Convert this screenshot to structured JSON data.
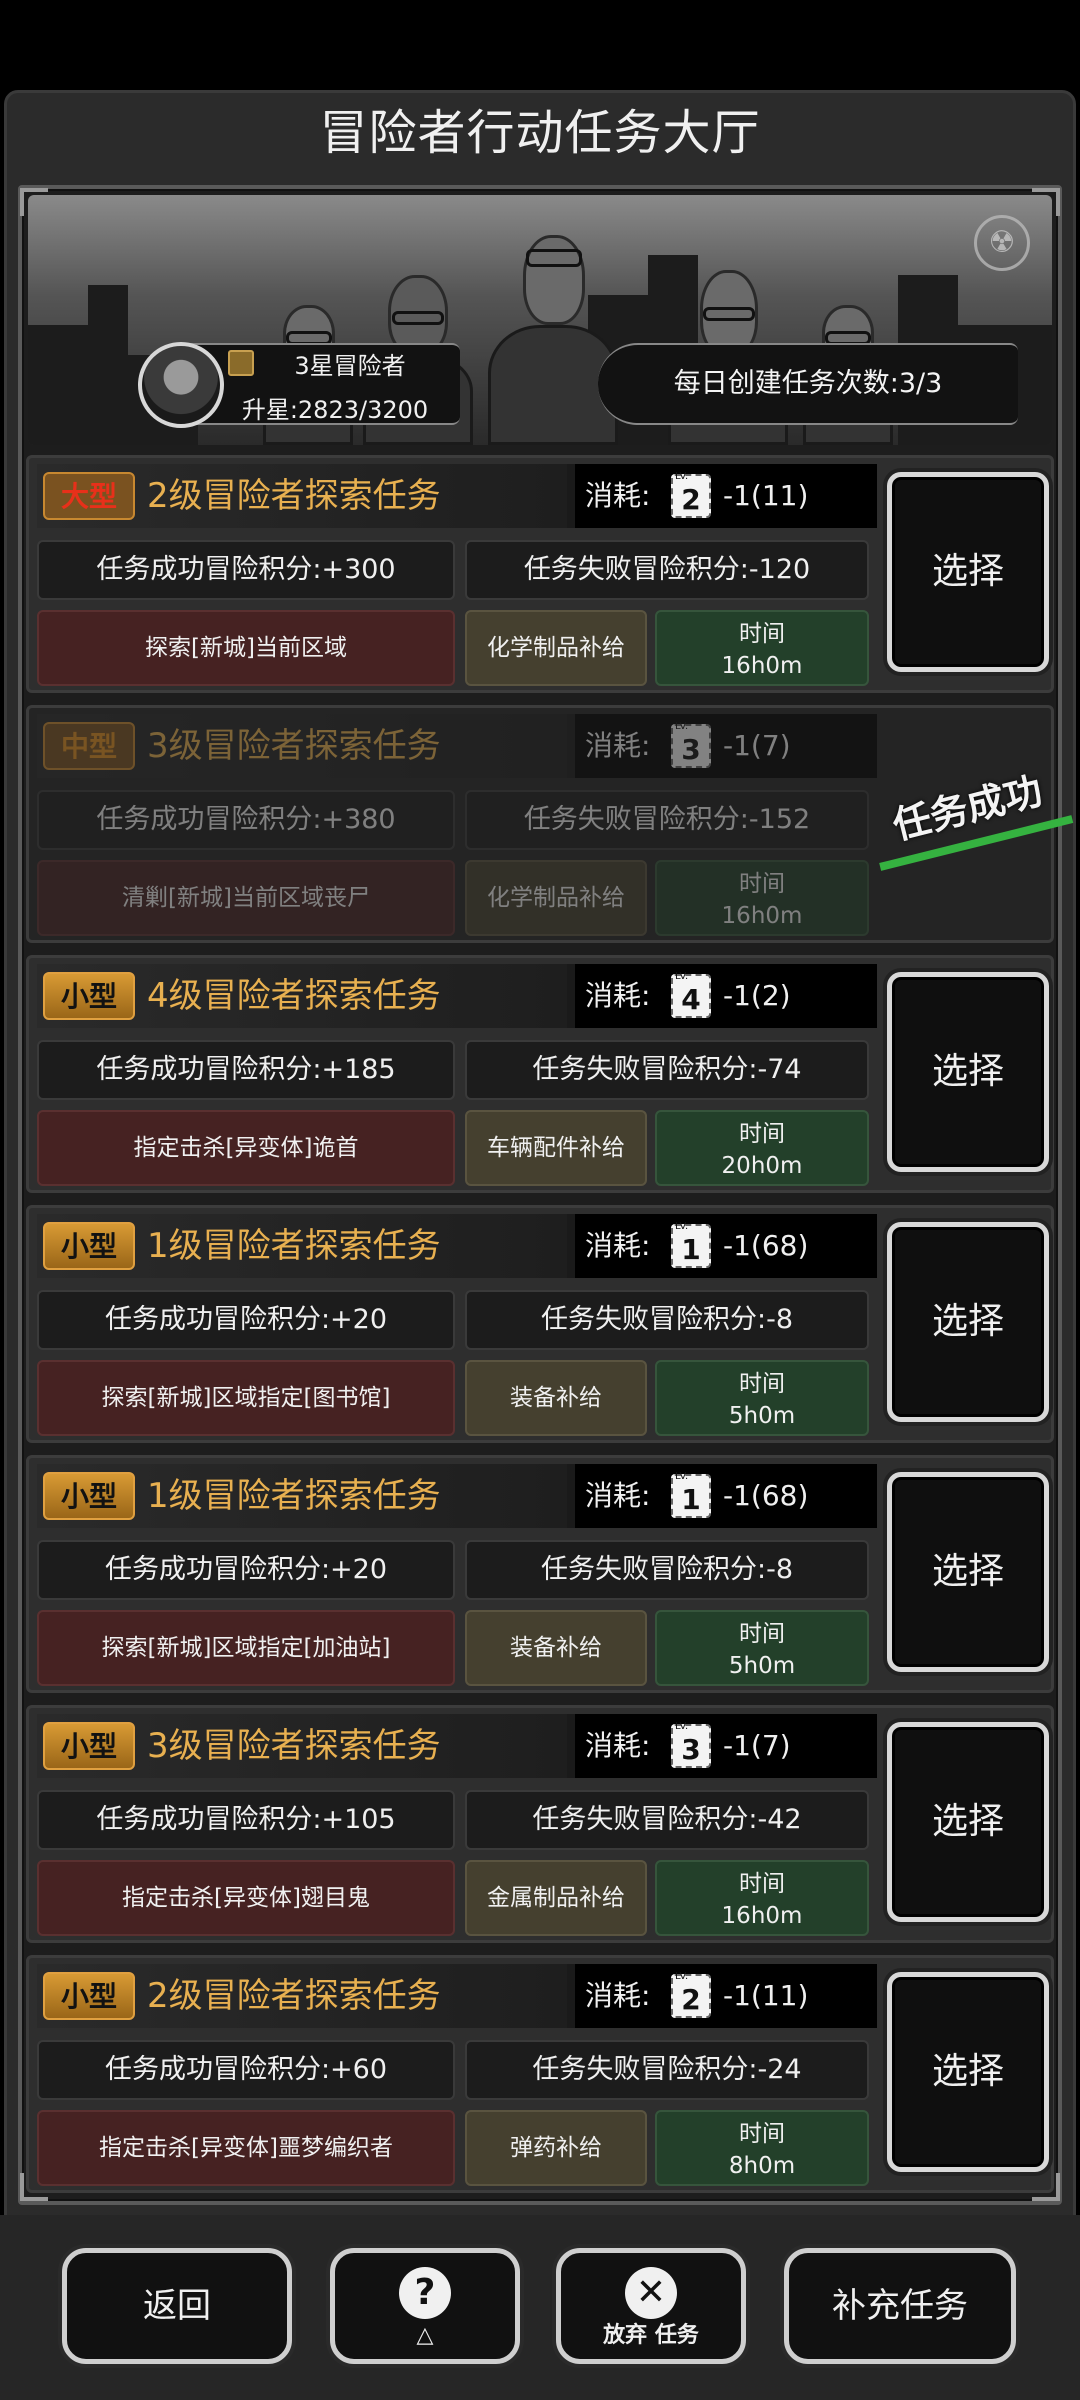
{
  "header": {
    "title": "冒险者行动任务大厅"
  },
  "profile": {
    "rank": "3星冒险者",
    "upgrade": "升星:2823/3200",
    "daily_create": "每日创建任务次数:3/3"
  },
  "tasks": [
    {
      "size": "大型",
      "size_class": "large",
      "title": "2级冒险者探索任务",
      "cost_label": "消耗:",
      "cost_level": "2",
      "cost_value": "-1(11)",
      "success": "任务成功冒险积分:+300",
      "fail": "任务失败冒险积分:-120",
      "objective": "探索[新城]当前区域",
      "supply": "化学制品补给",
      "time_label": "时间",
      "time_value": "16h0m",
      "button": "选择",
      "completed": false
    },
    {
      "size": "中型",
      "size_class": "medium",
      "title": "3级冒险者探索任务",
      "cost_label": "消耗:",
      "cost_level": "3",
      "cost_value": "-1(7)",
      "success": "任务成功冒险积分:+380",
      "fail": "任务失败冒险积分:-152",
      "objective": "清剿[新城]当前区域丧尸",
      "supply": "化学制品补给",
      "time_label": "时间",
      "time_value": "16h0m",
      "button": "",
      "completed": true,
      "stamp": "任务成功"
    },
    {
      "size": "小型",
      "size_class": "small",
      "title": "4级冒险者探索任务",
      "cost_label": "消耗:",
      "cost_level": "4",
      "cost_value": "-1(2)",
      "success": "任务成功冒险积分:+185",
      "fail": "任务失败冒险积分:-74",
      "objective": "指定击杀[异变体]诡首",
      "supply": "车辆配件补给",
      "time_label": "时间",
      "time_value": "20h0m",
      "button": "选择",
      "completed": false
    },
    {
      "size": "小型",
      "size_class": "small",
      "title": "1级冒险者探索任务",
      "cost_label": "消耗:",
      "cost_level": "1",
      "cost_value": "-1(68)",
      "success": "任务成功冒险积分:+20",
      "fail": "任务失败冒险积分:-8",
      "objective": "探索[新城]区域指定[图书馆]",
      "supply": "装备补给",
      "time_label": "时间",
      "time_value": "5h0m",
      "button": "选择",
      "completed": false
    },
    {
      "size": "小型",
      "size_class": "small",
      "title": "1级冒险者探索任务",
      "cost_label": "消耗:",
      "cost_level": "1",
      "cost_value": "-1(68)",
      "success": "任务成功冒险积分:+20",
      "fail": "任务失败冒险积分:-8",
      "objective": "探索[新城]区域指定[加油站]",
      "supply": "装备补给",
      "time_label": "时间",
      "time_value": "5h0m",
      "button": "选择",
      "completed": false
    },
    {
      "size": "小型",
      "size_class": "small",
      "title": "3级冒险者探索任务",
      "cost_label": "消耗:",
      "cost_level": "3",
      "cost_value": "-1(7)",
      "success": "任务成功冒险积分:+105",
      "fail": "任务失败冒险积分:-42",
      "objective": "指定击杀[异变体]翅目鬼",
      "supply": "金属制品补给",
      "time_label": "时间",
      "time_value": "16h0m",
      "button": "选择",
      "completed": false
    },
    {
      "size": "小型",
      "size_class": "small",
      "title": "2级冒险者探索任务",
      "cost_label": "消耗:",
      "cost_level": "2",
      "cost_value": "-1(11)",
      "success": "任务成功冒险积分:+60",
      "fail": "任务失败冒险积分:-24",
      "objective": "指定击杀[异变体]噩梦编织者",
      "supply": "弹药补给",
      "time_label": "时间",
      "time_value": "8h0m",
      "button": "选择",
      "completed": false
    }
  ],
  "bottom": {
    "back": "返回",
    "help_icon": "question-icon",
    "abandon_icon": "close-icon",
    "abandon": "放弃 任务",
    "refill": "补充任务"
  }
}
